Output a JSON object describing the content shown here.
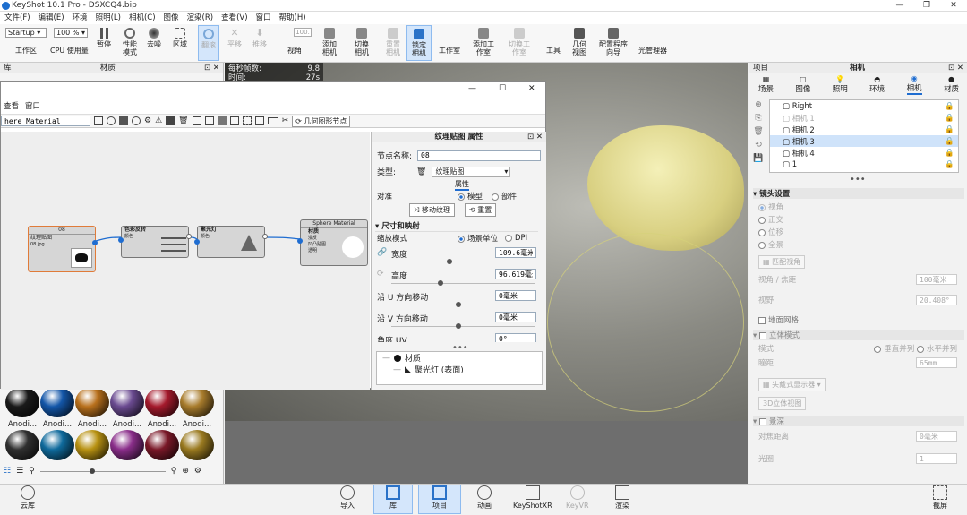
{
  "app": {
    "title": "KeyShot 10.1 Pro - DSXCQ4.bip"
  },
  "menu": [
    "文件(F)",
    "编辑(E)",
    "环境",
    "照明(L)",
    "相机(C)",
    "图像",
    "渲染(R)",
    "查看(V)",
    "窗口",
    "帮助(H)"
  ],
  "toolbar": {
    "workspace_value": "Startup",
    "zoom_value": "100 %",
    "items": [
      "工作区",
      "CPU 使用量",
      "暂停",
      "性能模式",
      "去噪",
      "区域",
      "翻滚",
      "平移",
      "推移",
      "视角",
      "添加相机",
      "切换相机",
      "重置相机",
      "锁定相机",
      "工作室",
      "添加工作室",
      "切换工作室",
      "工具",
      "几何视图",
      "配置程序向导",
      "光管理器"
    ]
  },
  "left_panel": {
    "tab1": "库",
    "tab2": "材质",
    "stats": [
      "每秒帧数:",
      "时间:"
    ],
    "stats_values": [
      "9.8",
      "27s"
    ]
  },
  "material_graph": {
    "menu": [
      "查看",
      "窗口"
    ],
    "material_name": "here Material",
    "geo_node_button": "几何图形节点",
    "nodes": {
      "texture": {
        "title": "08",
        "label": "纹理贴图",
        "sub": "08.jpg"
      },
      "color": {
        "title": "色彩反转",
        "sub": "颜色"
      },
      "spot": {
        "title": "聚光灯",
        "sub": "颜色"
      },
      "material": {
        "title": "Sphere Material",
        "label": "材质",
        "ports": [
          "漫反",
          "凹凸贴图",
          "透明"
        ]
      }
    }
  },
  "props": {
    "title": "纹理贴图 属性",
    "node_name_label": "节点名称:",
    "node_name_value": "08",
    "type_label": "类型:",
    "type_value": "纹理贴图",
    "tab": "属性",
    "align_label": "对准",
    "align_opts": [
      "模型",
      "部件"
    ],
    "move_btn": "移动纹理",
    "reset_btn": "重置",
    "section": "尺寸和映射",
    "scale_label": "缩放模式",
    "scale_opts": [
      "场景单位",
      "DPI"
    ],
    "width_label": "宽度",
    "width_value": "109.6毫米",
    "height_label": "高度",
    "height_value": "96.619毫米",
    "u_label": "沿 U 方向移动",
    "u_value": "0毫米",
    "v_label": "沿 V 方向移动",
    "v_value": "0毫米",
    "angle_label": "角度 UV",
    "angle_value": "0°",
    "tree": [
      "材质",
      "聚光灯 (表面)"
    ]
  },
  "materials": {
    "row_labels": [
      "Anodi...",
      "Anodi...",
      "Anodi...",
      "Anodi...",
      "Anodi...",
      "Anodi..."
    ],
    "colors_row1": [
      "#1a1a1a",
      "#1356a8",
      "#b8701c",
      "#6a4a90",
      "#a41a2c",
      "#a87c2c"
    ],
    "colors_row2": [
      "#303030",
      "#0f6a9c",
      "#b89212",
      "#8a2e8a",
      "#7a1828",
      "#9a7a20"
    ]
  },
  "right_panel": {
    "title_left": "项目",
    "title": "相机",
    "tabs": [
      "场景",
      "图像",
      "照明",
      "环境",
      "相机",
      "材质"
    ],
    "cameras": [
      "Right",
      "相机 1",
      "相机 2",
      "相机 3",
      "相机 4",
      "1"
    ],
    "lens_section": "镜头设置",
    "lens_opts": [
      "视角",
      "正交",
      "位移",
      "全景"
    ],
    "match_btn": "匹配视角",
    "fov_label": "视角 / 焦距",
    "fov_value": "100毫米",
    "view_label": "视野",
    "view_value": "20.408°",
    "ground_grid": "地面网格",
    "stereo_section": "立体模式",
    "mode_label": "模式",
    "mode_opts": [
      "垂直并列",
      "水平并列"
    ],
    "eye_label": "瞳距",
    "eye_value": "65mm",
    "headset_btn": "头戴式显示器",
    "stereo_btn": "3D立体视图",
    "dof_section": "景深",
    "focus_label": "对焦距离",
    "focus_value": "0毫米",
    "aperture_label": "光圈",
    "aperture_value": "1"
  },
  "bottom": {
    "left": "云库",
    "items": [
      "导入",
      "库",
      "项目",
      "动画",
      "KeyShotXR",
      "KeyVR",
      "渲染"
    ],
    "right": "截屏"
  }
}
